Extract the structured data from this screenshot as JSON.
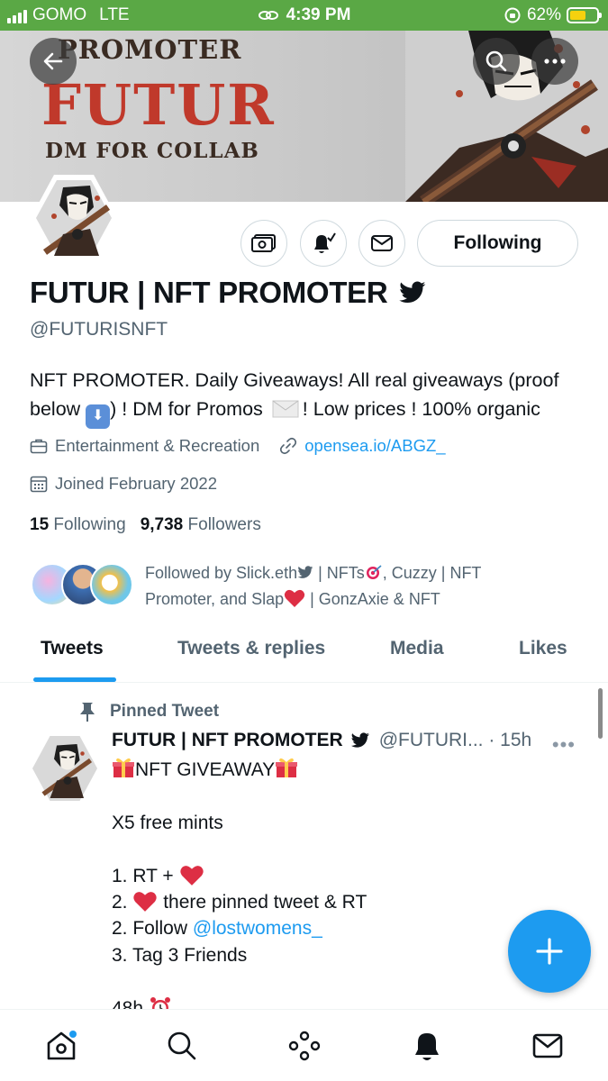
{
  "status_bar": {
    "carrier": "GOMO",
    "network": "LTE",
    "time": "4:39 PM",
    "battery": "62%",
    "battery_level": 0.62
  },
  "banner": {
    "line1": "PROMOTER",
    "line2": "FUTUR",
    "line3": "DM FOR COLLAB"
  },
  "profile": {
    "name": "FUTUR | NFT PROMOTER",
    "handle": "@FUTURISNFT",
    "bio_part1": "NFT PROMOTER. Daily Giveaways! All real giveaways (proof below",
    "bio_part2": ") ! DM for Promos",
    "bio_part3": "! Low prices ! 100% organic",
    "category": "Entertainment & Recreation",
    "link": "opensea.io/ABGZ_",
    "joined": "Joined February 2022",
    "following_count": "15",
    "following_label": "Following",
    "followers_count": "9,738",
    "followers_label": "Followers",
    "followed_by_line1": "Followed by Slick.eth",
    "followed_by_line1b": " | NFTs",
    "followed_by_line1c": ", Cuzzy | NFT",
    "followed_by_line2": "Promoter, and Slap",
    "followed_by_line2b": " | GonzAxie & NFT"
  },
  "actions": {
    "following_label": "Following"
  },
  "tabs": [
    "Tweets",
    "Tweets & replies",
    "Media",
    "Likes"
  ],
  "active_tab": "Tweets",
  "pinned_tweet": {
    "pinned_label": "Pinned Tweet",
    "name": "FUTUR | NFT PROMOTER",
    "handle_time": "@FUTURI... · 15h",
    "more": "•••",
    "title": "NFT GIVEAWAY",
    "line_x5": "X5 free mints",
    "line_rt": "1. RT +",
    "line_pinned_a": "2.",
    "line_pinned_b": "there pinned tweet & RT",
    "line_follow_a": "2. Follow ",
    "line_follow_mention": "@lostwomens_",
    "line_tag": "3. Tag 3 Friends",
    "line_48h": "48h"
  },
  "colors": {
    "accent": "#1d9bf0",
    "status_bar": "#5aa845",
    "banner_red": "#c0392b",
    "text": "#0f1419",
    "muted": "#536471"
  },
  "icons": [
    "back-arrow-icon",
    "search-icon",
    "more-icon",
    "money-icon",
    "bell-subscribed-icon",
    "mail-icon",
    "verified-badge-icon",
    "briefcase-icon",
    "link-icon",
    "calendar-icon",
    "pin-icon",
    "compose-plus-icon",
    "home-icon",
    "explore-icon",
    "spaces-icon",
    "notifications-icon",
    "messages-icon"
  ]
}
